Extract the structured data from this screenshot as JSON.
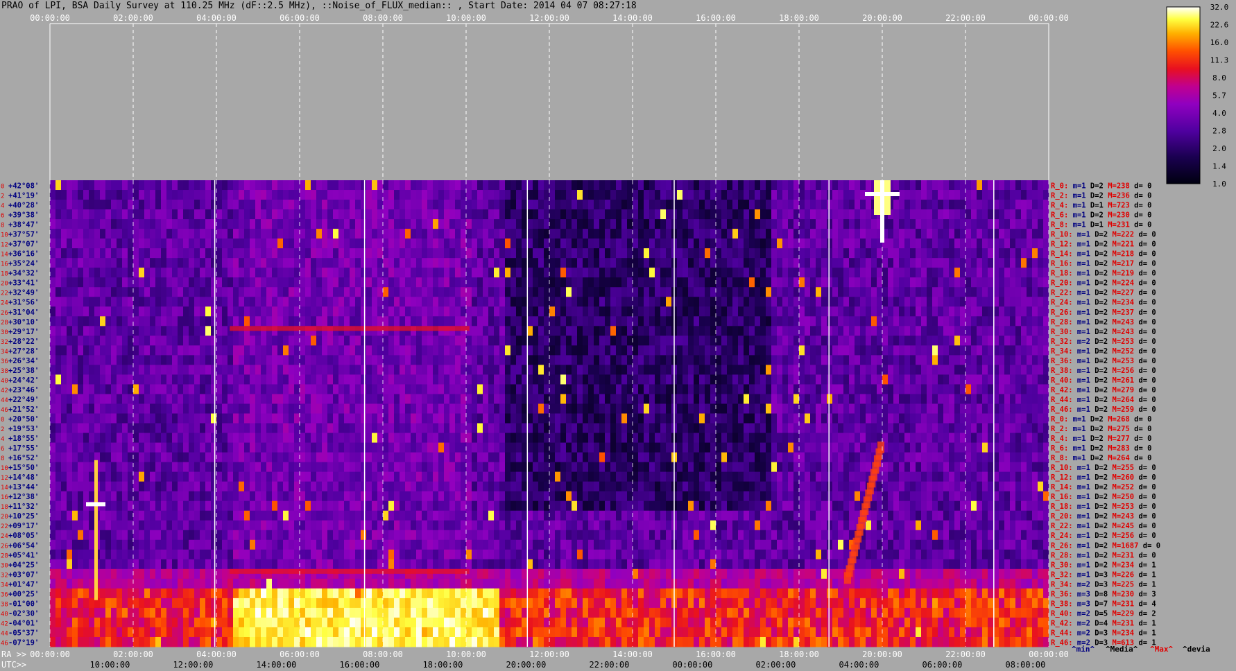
{
  "title": "PRAO of LPI, BSA Daily Survey at 110.25 MHz (dF::2.5 MHz), ::Noise_of_FLUX_median:: , Start Date: 2014 04 07 08:27:18",
  "colors": {
    "background": "#a8a8a8",
    "label_red": "#e00000",
    "label_navy": "#000080",
    "label_black": "#000000"
  },
  "bottom_axis": {
    "ra_prefix": "RA >>",
    "utc_prefix": "UTC>>"
  },
  "footer_legend": {
    "min": "^min^",
    "media": "^Media^",
    "max": "^Max^",
    "devia": "^devia"
  },
  "chart_data": {
    "type": "heatmap",
    "title": "PRAO of LPI, BSA Daily Survey at 110.25 MHz (dF::2.5 MHz), ::Noise_of_FLUX_median:: , Start Date: 2014 04 07 08:27:18",
    "top_ticks": [
      "00:00:00",
      "02:00:00",
      "04:00:00",
      "06:00:00",
      "08:00:00",
      "10:00:00",
      "12:00:00",
      "14:00:00",
      "16:00:00",
      "18:00:00",
      "20:00:00",
      "22:00:00",
      "00:00:00"
    ],
    "ra_ticks": [
      "00:00:00",
      "02:00:00",
      "04:00:00",
      "06:00:00",
      "08:00:00",
      "10:00:00",
      "12:00:00",
      "14:00:00",
      "16:00:00",
      "18:00:00",
      "20:00:00",
      "22:00:00",
      "00:00:00"
    ],
    "utc_ticks": [
      "10:00:00",
      "12:00:00",
      "14:00:00",
      "16:00:00",
      "18:00:00",
      "20:00:00",
      "22:00:00",
      "00:00:00",
      "02:00:00",
      "04:00:00",
      "06:00:00",
      "08:00:00"
    ],
    "colorbar_ticks": [
      "32.0",
      "22.6",
      "16.0",
      "11.3",
      "8.0",
      "5.7",
      "4.0",
      "2.8",
      "2.0",
      "1.4",
      "1.0"
    ],
    "colorbar_range": [
      1.0,
      32.0
    ],
    "colorbar_scale": "log",
    "declinations": [
      "+42°08'",
      "+41°19'",
      "+40°28'",
      "+39°38'",
      "+38°47'",
      "+37°57'",
      "+37°07'",
      "+36°16'",
      "+35°24'",
      "+34°32'",
      "+33°41'",
      "+32°49'",
      "+31°56'",
      "+31°04'",
      "+30°10'",
      "+29°17'",
      "+28°22'",
      "+27°28'",
      "+26°34'",
      "+25°38'",
      "+24°42'",
      "+23°46'",
      "+22°49'",
      "+21°52'",
      "+20°50'",
      "+19°53'",
      "+18°55'",
      "+17°55'",
      "+16°52'",
      "+15°50'",
      "+14°48'",
      "+13°44'",
      "+12°38'",
      "+11°32'",
      "+10°25'",
      "+09°17'",
      "+08°05'",
      "+06°54'",
      "+05°41'",
      "+04°25'",
      "+03°07'",
      "+01°47'",
      "+00°25'",
      "-01°00'",
      "-02°30'",
      "-04°01'",
      "-05°37'",
      "-07°19'"
    ],
    "row_index_labels": [
      "0",
      "2",
      "4",
      "6",
      "8",
      "10",
      "12",
      "14",
      "16",
      "18",
      "20",
      "22",
      "24",
      "26",
      "28",
      "30",
      "32",
      "34",
      "36",
      "38",
      "40",
      "42",
      "44",
      "46",
      "0",
      "2",
      "4",
      "6",
      "8",
      "10",
      "12",
      "14",
      "16",
      "18",
      "20",
      "22",
      "24",
      "26",
      "28",
      "30",
      "32",
      "34",
      "36",
      "38",
      "40",
      "42",
      "44",
      "46"
    ],
    "row_stats": [
      {
        "r": "R_0:",
        "m": "m=1",
        "D": "D=2",
        "M": "M=238",
        "d": "d= 0"
      },
      {
        "r": "R_2:",
        "m": "m=1",
        "D": "D=2",
        "M": "M=236",
        "d": "d= 0"
      },
      {
        "r": "R_4:",
        "m": "m=1",
        "D": "D=1",
        "M": "M=723",
        "d": "d= 0"
      },
      {
        "r": "R_6:",
        "m": "m=1",
        "D": "D=2",
        "M": "M=230",
        "d": "d= 0"
      },
      {
        "r": "R_8:",
        "m": "m=1",
        "D": "D=1",
        "M": "M=231",
        "d": "d= 0"
      },
      {
        "r": "R_10:",
        "m": "m=1",
        "D": "D=2",
        "M": "M=222",
        "d": "d= 0"
      },
      {
        "r": "R_12:",
        "m": "m=1",
        "D": "D=2",
        "M": "M=221",
        "d": "d= 0"
      },
      {
        "r": "R_14:",
        "m": "m=1",
        "D": "D=2",
        "M": "M=218",
        "d": "d= 0"
      },
      {
        "r": "R_16:",
        "m": "m=1",
        "D": "D=2",
        "M": "M=217",
        "d": "d= 0"
      },
      {
        "r": "R_18:",
        "m": "m=1",
        "D": "D=2",
        "M": "M=219",
        "d": "d= 0"
      },
      {
        "r": "R_20:",
        "m": "m=1",
        "D": "D=2",
        "M": "M=224",
        "d": "d= 0"
      },
      {
        "r": "R_22:",
        "m": "m=1",
        "D": "D=2",
        "M": "M=227",
        "d": "d= 0"
      },
      {
        "r": "R_24:",
        "m": "m=1",
        "D": "D=2",
        "M": "M=234",
        "d": "d= 0"
      },
      {
        "r": "R_26:",
        "m": "m=1",
        "D": "D=2",
        "M": "M=237",
        "d": "d= 0"
      },
      {
        "r": "R_28:",
        "m": "m=1",
        "D": "D=2",
        "M": "M=243",
        "d": "d= 0"
      },
      {
        "r": "R_30:",
        "m": "m=1",
        "D": "D=2",
        "M": "M=243",
        "d": "d= 0"
      },
      {
        "r": "R_32:",
        "m": "m=2",
        "D": "D=2",
        "M": "M=253",
        "d": "d= 0"
      },
      {
        "r": "R_34:",
        "m": "m=1",
        "D": "D=2",
        "M": "M=252",
        "d": "d= 0"
      },
      {
        "r": "R_36:",
        "m": "m=1",
        "D": "D=2",
        "M": "M=253",
        "d": "d= 0"
      },
      {
        "r": "R_38:",
        "m": "m=1",
        "D": "D=2",
        "M": "M=256",
        "d": "d= 0"
      },
      {
        "r": "R_40:",
        "m": "m=1",
        "D": "D=2",
        "M": "M=261",
        "d": "d= 0"
      },
      {
        "r": "R_42:",
        "m": "m=1",
        "D": "D=2",
        "M": "M=279",
        "d": "d= 0"
      },
      {
        "r": "R_44:",
        "m": "m=1",
        "D": "D=2",
        "M": "M=264",
        "d": "d= 0"
      },
      {
        "r": "R_46:",
        "m": "m=1",
        "D": "D=2",
        "M": "M=259",
        "d": "d= 0"
      },
      {
        "r": "R_0:",
        "m": "m=1",
        "D": "D=2",
        "M": "M=268",
        "d": "d= 0"
      },
      {
        "r": "R_2:",
        "m": "m=1",
        "D": "D=2",
        "M": "M=275",
        "d": "d= 0"
      },
      {
        "r": "R_4:",
        "m": "m=1",
        "D": "D=2",
        "M": "M=277",
        "d": "d= 0"
      },
      {
        "r": "R_6:",
        "m": "m=1",
        "D": "D=2",
        "M": "M=283",
        "d": "d= 0"
      },
      {
        "r": "R_8:",
        "m": "m=1",
        "D": "D=2",
        "M": "M=264",
        "d": "d= 0"
      },
      {
        "r": "R_10:",
        "m": "m=1",
        "D": "D=2",
        "M": "M=255",
        "d": "d= 0"
      },
      {
        "r": "R_12:",
        "m": "m=1",
        "D": "D=2",
        "M": "M=260",
        "d": "d= 0"
      },
      {
        "r": "R_14:",
        "m": "m=1",
        "D": "D=2",
        "M": "M=252",
        "d": "d= 0"
      },
      {
        "r": "R_16:",
        "m": "m=1",
        "D": "D=2",
        "M": "M=250",
        "d": "d= 0"
      },
      {
        "r": "R_18:",
        "m": "m=1",
        "D": "D=2",
        "M": "M=253",
        "d": "d= 0"
      },
      {
        "r": "R_20:",
        "m": "m=1",
        "D": "D=2",
        "M": "M=243",
        "d": "d= 0"
      },
      {
        "r": "R_22:",
        "m": "m=1",
        "D": "D=2",
        "M": "M=245",
        "d": "d= 0"
      },
      {
        "r": "R_24:",
        "m": "m=1",
        "D": "D=2",
        "M": "M=256",
        "d": "d= 0"
      },
      {
        "r": "R_26:",
        "m": "m=1",
        "D": "D=2",
        "M": "M=1687",
        "d": "d= 0"
      },
      {
        "r": "R_28:",
        "m": "m=1",
        "D": "D=2",
        "M": "M=231",
        "d": "d= 0"
      },
      {
        "r": "R_30:",
        "m": "m=1",
        "D": "D=2",
        "M": "M=234",
        "d": "d= 1"
      },
      {
        "r": "R_32:",
        "m": "m=1",
        "D": "D=3",
        "M": "M=226",
        "d": "d= 1"
      },
      {
        "r": "R_34:",
        "m": "m=2",
        "D": "D=3",
        "M": "M=225",
        "d": "d= 1"
      },
      {
        "r": "R_36:",
        "m": "m=3",
        "D": "D=8",
        "M": "M=230",
        "d": "d= 3"
      },
      {
        "r": "R_38:",
        "m": "m=3",
        "D": "D=7",
        "M": "M=231",
        "d": "d= 4"
      },
      {
        "r": "R_40:",
        "m": "m=2",
        "D": "D=5",
        "M": "M=229",
        "d": "d= 2"
      },
      {
        "r": "R_42:",
        "m": "m=2",
        "D": "D=4",
        "M": "M=231",
        "d": "d= 1"
      },
      {
        "r": "R_44:",
        "m": "m=2",
        "D": "D=3",
        "M": "M=234",
        "d": "d= 1"
      },
      {
        "r": "R_46:",
        "m": "m=2",
        "D": "D=3",
        "M": "M=613",
        "d": "d= 1"
      }
    ]
  }
}
